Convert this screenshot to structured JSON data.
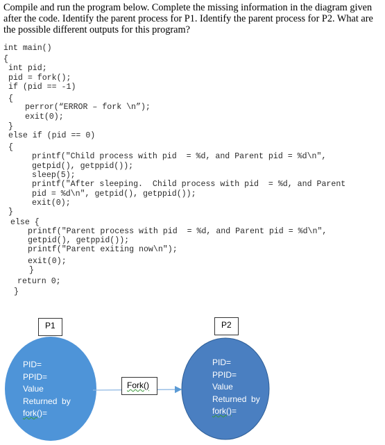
{
  "question": "Compile and run the program below.  Complete the missing information in the diagram given after the code.  Identify the parent process for P1.  Identify the parent process for P2.  What are the possible different outputs for this program?",
  "code": [
    "int main()",
    "{",
    "int pid;",
    "pid = fork();",
    "if (pid == -1)",
    "{",
    "perror(“ERROR – fork \\n”);",
    "exit(0);",
    "}",
    "else if (pid == 0)",
    "{",
    "printf(\"Child process with pid  = %d, and Parent pid = %d\\n\",",
    "getpid(), getppid());",
    "sleep(5);",
    "printf(\"After sleeping.  Child process with pid  = %d, and Parent",
    "pid = %d\\n\", getpid(), getppid());",
    "exit(0);",
    "}",
    "else {",
    "printf(\"Parent process with pid  = %d, and Parent pid = %d\\n\",",
    "getpid(), getppid());",
    "printf(\"Parent exiting now\\n\");",
    "exit(0);",
    "}",
    "return 0;",
    "}"
  ],
  "diagram": {
    "p1": {
      "label": "P1",
      "lines": [
        "PID=",
        "PPID=",
        "Value",
        "Returned  by"
      ],
      "last": "fork()",
      "last_suffix": "=",
      "color": "#4e94d8"
    },
    "p2": {
      "label": "P2",
      "lines": [
        "PID=",
        "PPID=",
        "Value",
        "Returned  by"
      ],
      "last": "fork()",
      "last_suffix": "=",
      "color": "#4a7fc1"
    },
    "fork_label": "Fork()"
  }
}
